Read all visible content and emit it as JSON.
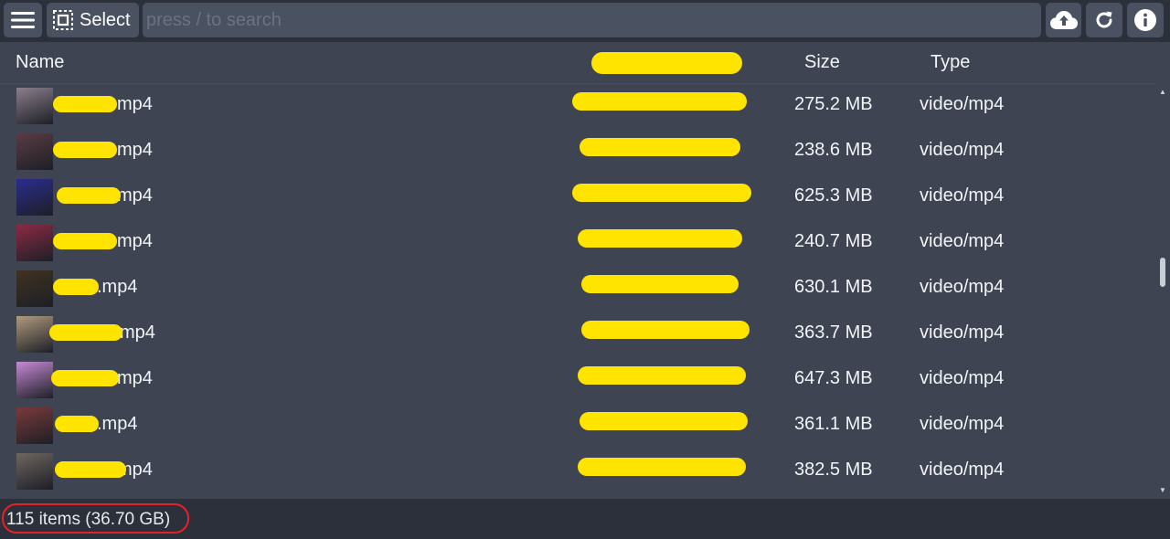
{
  "toolbar": {
    "menu_icon": "hamburger-menu-icon",
    "select_label": "Select",
    "select_icon": "select-box-icon",
    "search_placeholder": "press / to search",
    "search_value": "",
    "upload_icon": "cloud-upload-icon",
    "refresh_icon": "refresh-icon",
    "info_icon": "info-icon"
  },
  "table": {
    "columns": {
      "name": "Name",
      "date": "",
      "size": "Size",
      "type": "Type"
    },
    "rows": [
      {
        "name": "mp4",
        "size": "275.2 MB",
        "type": "video/mp4",
        "thumb": "#8a7f8c"
      },
      {
        "name": "mp4",
        "size": "238.6 MB",
        "type": "video/mp4",
        "thumb": "#5a3c44"
      },
      {
        "name": "mp4",
        "size": "625.3 MB",
        "type": "video/mp4",
        "thumb": "#2b2c8f"
      },
      {
        "name": "mp4",
        "size": "240.7 MB",
        "type": "video/mp4",
        "thumb": "#8c2a44"
      },
      {
        "name": ".mp4",
        "size": "630.1 MB",
        "type": "video/mp4",
        "thumb": "#3f3220"
      },
      {
        "name": "mp4",
        "size": "363.7 MB",
        "type": "video/mp4",
        "thumb": "#b09a7e"
      },
      {
        "name": "mp4",
        "size": "647.3 MB",
        "type": "video/mp4",
        "thumb": "#c68ad4"
      },
      {
        "name": ".mp4",
        "size": "361.1 MB",
        "type": "video/mp4",
        "thumb": "#7a3a3c"
      },
      {
        "name": "mp4",
        "size": "382.5 MB",
        "type": "video/mp4",
        "thumb": "#6e6660"
      }
    ]
  },
  "status": {
    "summary": "115 items (36.70 GB)"
  },
  "colors": {
    "background": "#2b303a",
    "panel": "#3e4452",
    "button": "#4a5160",
    "redaction": "#ffe400",
    "annotation": "#e0242a"
  }
}
